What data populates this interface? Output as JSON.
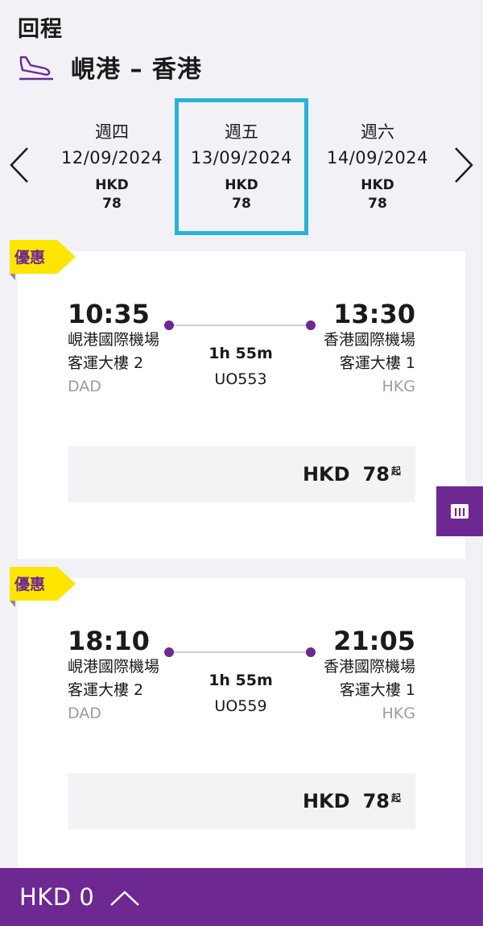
{
  "header": {
    "subtitle": "回程",
    "route": "峴港 – 香港",
    "plane_icon": "plane-landing-icon"
  },
  "dates": [
    {
      "dow": "週四",
      "date": "12/09/2024",
      "currency": "HKD",
      "price": "78",
      "selected": false
    },
    {
      "dow": "週五",
      "date": "13/09/2024",
      "currency": "HKD",
      "price": "78",
      "selected": true
    },
    {
      "dow": "週六",
      "date": "14/09/2024",
      "currency": "HKD",
      "price": "78",
      "selected": false
    }
  ],
  "flights": [
    {
      "badge": "優惠",
      "dep_time": "10:35",
      "dep_airport": "峴港國際機場",
      "dep_terminal": "客運大樓 2",
      "dep_code": "DAD",
      "arr_time": "13:30",
      "arr_airport": "香港國際機場",
      "arr_terminal": "客運大樓 1",
      "arr_code": "HKG",
      "duration": "1h 55m",
      "flight_no": "UO553",
      "price_currency": "HKD",
      "price": "78",
      "price_suffix": "起"
    },
    {
      "badge": "優惠",
      "dep_time": "18:10",
      "dep_airport": "峴港國際機場",
      "dep_terminal": "客運大樓 2",
      "dep_code": "DAD",
      "arr_time": "21:05",
      "arr_airport": "香港國際機場",
      "arr_terminal": "客運大樓 1",
      "arr_code": "HKG",
      "duration": "1h 55m",
      "flight_no": "UO559",
      "price_currency": "HKD",
      "price": "78",
      "price_suffix": "起"
    }
  ],
  "bottom_bar": {
    "total": "HKD 0"
  },
  "colors": {
    "brand_purple": "#6d2891",
    "selected_border": "#27b3d6",
    "badge_yellow": "#fde500"
  }
}
